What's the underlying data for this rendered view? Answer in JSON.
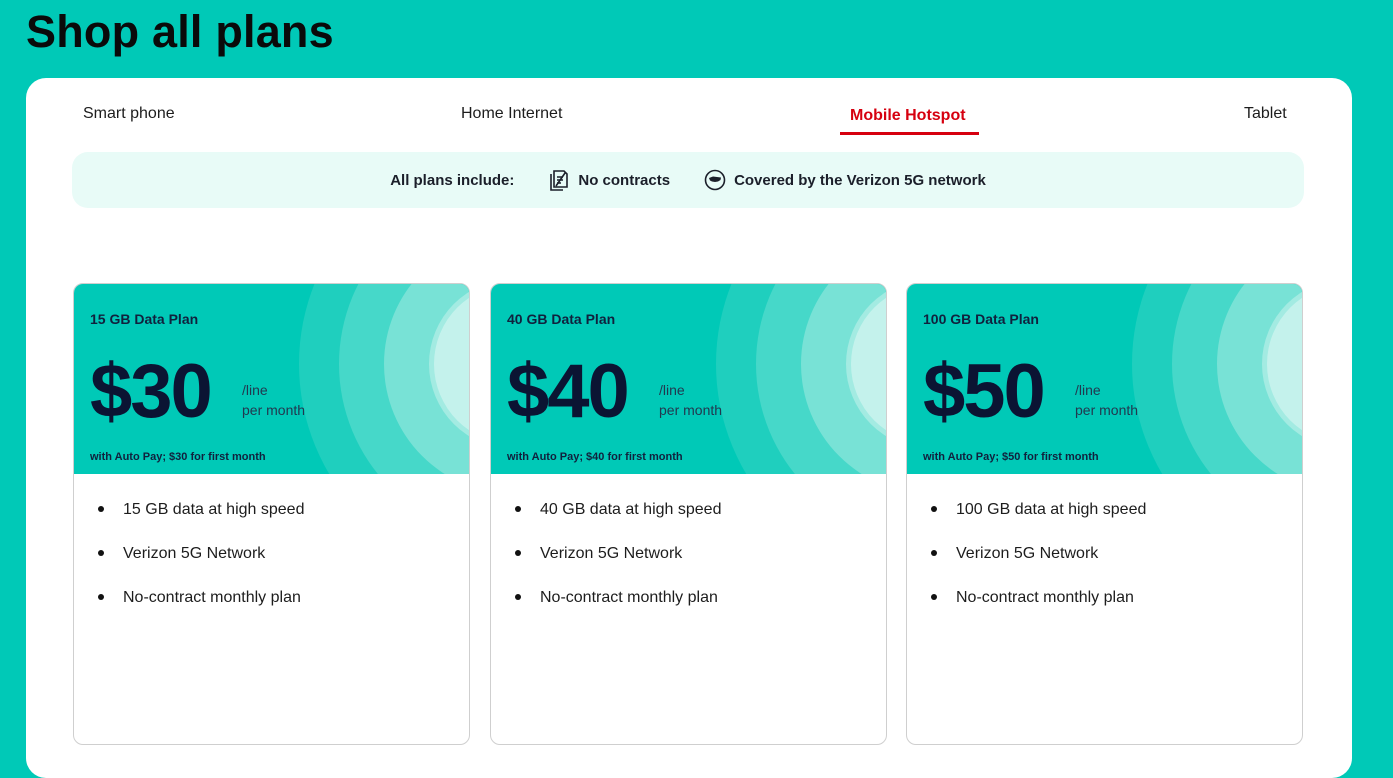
{
  "page": {
    "title": "Shop all plans"
  },
  "tabs": [
    {
      "label": "Smart phone",
      "active": false
    },
    {
      "label": "Home Internet",
      "active": false
    },
    {
      "label": "Mobile Hotspot",
      "active": true
    },
    {
      "label": "Tablet",
      "active": false
    }
  ],
  "includes": {
    "label": "All plans include:",
    "items": [
      {
        "label": "No contracts",
        "icon": "document-icon"
      },
      {
        "label": "Covered by the Verizon 5G network",
        "icon": "usa-map-icon"
      }
    ]
  },
  "plans": [
    {
      "name": "15 GB Data Plan",
      "price": "$30",
      "per_line": "/line",
      "per_month": "per month",
      "autopay": "with Auto Pay; $30 for first month",
      "features": [
        "15 GB data at high speed",
        "Verizon 5G Network",
        "No-contract monthly plan"
      ]
    },
    {
      "name": "40 GB Data Plan",
      "price": "$40",
      "per_line": "/line",
      "per_month": "per month",
      "autopay": "with Auto Pay; $40 for first month",
      "features": [
        "40 GB data at high speed",
        "Verizon 5G Network",
        "No-contract monthly plan"
      ]
    },
    {
      "name": "100 GB Data Plan",
      "price": "$50",
      "per_line": "/line",
      "per_month": "per month",
      "autopay": "with Auto Pay; $50 for first month",
      "features": [
        "100 GB data at high speed",
        "Verizon 5G Network",
        "No-contract monthly plan"
      ]
    }
  ],
  "colors": {
    "background": "#00c9b7",
    "accent_red": "#d6000f",
    "card_header": "#00c9b7",
    "price_text": "#0b1433"
  }
}
